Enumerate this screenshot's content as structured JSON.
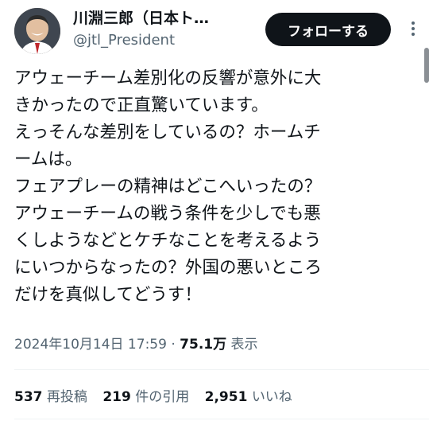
{
  "author": {
    "display_name": "川淵三郎（日本ト…",
    "handle": "@jtl_President",
    "avatar_icon": "user-avatar"
  },
  "follow_button": {
    "label": "フォローする"
  },
  "more_icon": "more-dots-icon",
  "tweet": {
    "lines": [
      "アウェーチーム差別化の反響が意外に大",
      "きかったので正直驚いています。",
      "えっそんな差別をしているの？ホームチ",
      "ームは。",
      "フェアプレーの精神はどこへいったの？",
      "アウェーチームの戦う条件を少しでも悪",
      "くしようなどとケチなことを考えるよう",
      "にいつからなったの？外国の悪いところ",
      "だけを真似してどうす！"
    ]
  },
  "meta": {
    "timestamp": "2024年10月14日 17:59",
    "separator": "·",
    "views_count": "75.1万",
    "views_label": "表示"
  },
  "stats": {
    "retweets_count": "537",
    "retweets_label": "再投稿",
    "quotes_count": "219",
    "quotes_label": "件の引用",
    "likes_count": "2,951",
    "likes_label": "いいね"
  },
  "colors": {
    "text_primary": "#0f1419",
    "text_secondary": "#536471",
    "button_bg": "#0f1419",
    "button_text": "#ffffff",
    "divider": "#eff3f4"
  }
}
